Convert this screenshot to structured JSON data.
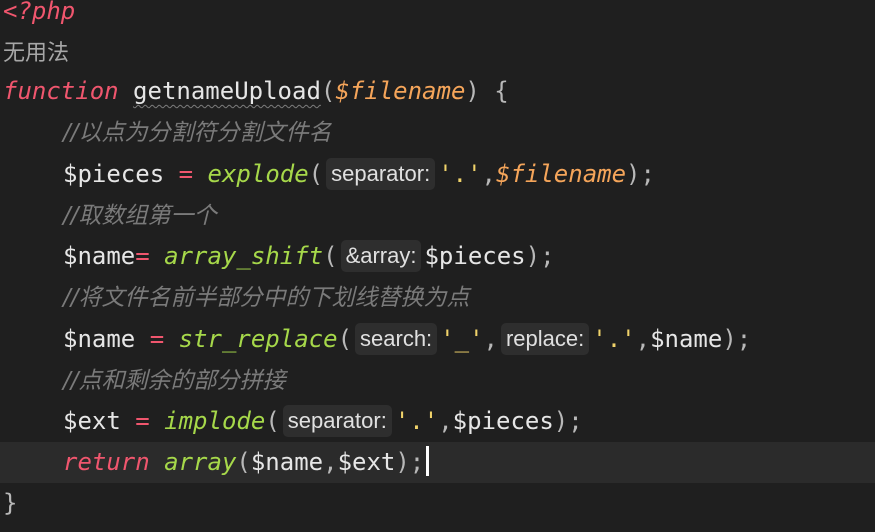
{
  "code": {
    "php_open": "<?php",
    "note": "无用法",
    "fn_keyword": "function",
    "fn_name": "getnameUpload",
    "open_paren": "(",
    "fn_param": "$filename",
    "close_brace_open": ") {",
    "comment1": "//以点为分割符分割文件名",
    "l4_var": "$pieces",
    "l4_eq": " = ",
    "l4_fn": "explode",
    "l4_hint": "separator:",
    "l4_str": "'.'",
    "l4_comma": ",",
    "l4_param": "$filename",
    "l4_end": ");",
    "comment2": "//取数组第一个",
    "l6_var": "$name",
    "l6_eq": "= ",
    "l6_fn": "array_shift",
    "l6_hint": "&array:",
    "l6_arg": "$pieces",
    "l6_end": ");",
    "comment3": "//将文件名前半部分中的下划线替换为点",
    "l8_var": "$name",
    "l8_eq": " = ",
    "l8_fn": "str_replace",
    "l8_hint1": "search:",
    "l8_str1": "'_'",
    "l8_comma1": ",",
    "l8_hint2": "replace:",
    "l8_str2": "'.'",
    "l8_comma2": ",",
    "l8_arg": "$name",
    "l8_end": ");",
    "comment4": "//点和剩余的部分拼接",
    "l10_var": "$ext",
    "l10_eq": " = ",
    "l10_fn": "implode",
    "l10_hint": "separator:",
    "l10_str": "'.'",
    "l10_comma": ",",
    "l10_arg": "$pieces",
    "l10_end": ");",
    "l11_kw": "return",
    "l11_fn": "array",
    "l11_open": "(",
    "l11_a1": "$name",
    "l11_comma": ",",
    "l11_a2": "$ext",
    "l11_end": ");",
    "close": "}"
  },
  "colors": {
    "background": "#1f1f1f",
    "current_line": "#2b2b2b",
    "keyword": "#f0566e",
    "function": "#a6d84a",
    "parameter": "#f5a55a",
    "string": "#f0d36a",
    "comment": "#7a7a7a"
  }
}
